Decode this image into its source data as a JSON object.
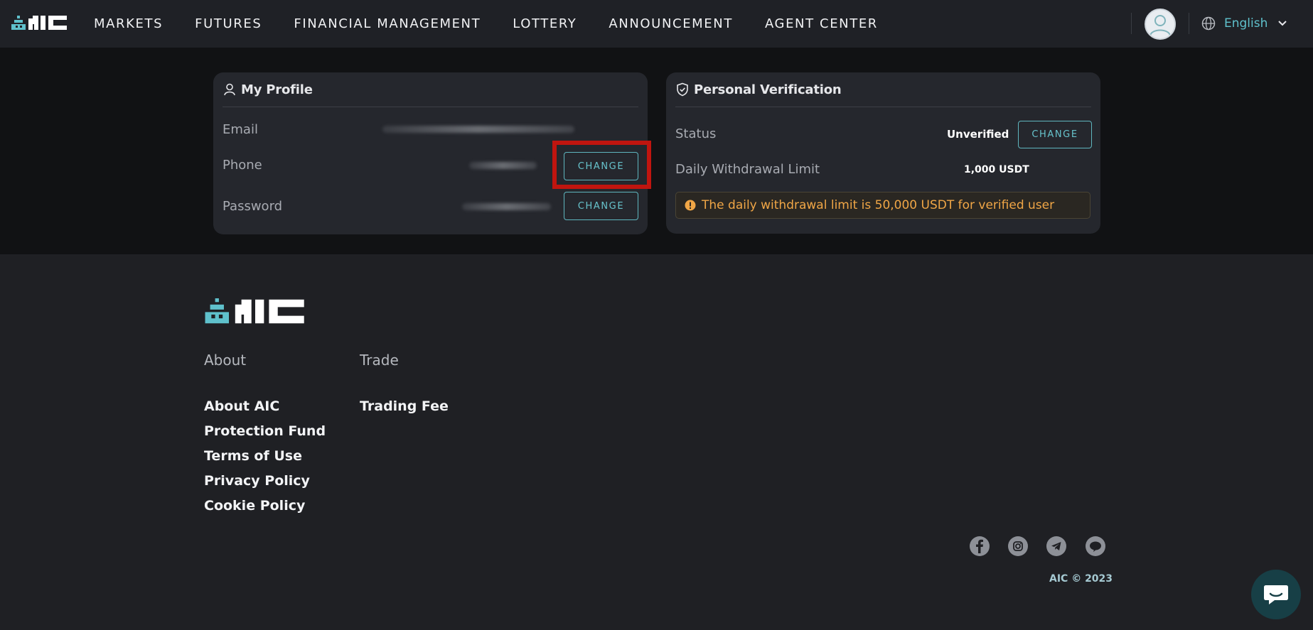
{
  "brand": {
    "name": "AIC",
    "logo_color": "#5fc1cc"
  },
  "nav": {
    "links": [
      "MARKETS",
      "FUTURES",
      "FINANCIAL MANAGEMENT",
      "LOTTERY",
      "ANNOUNCEMENT",
      "AGENT CENTER"
    ],
    "language": "English"
  },
  "profile": {
    "title": "My Profile",
    "rows": [
      {
        "label": "Email"
      },
      {
        "label": "Phone",
        "action": "CHANGE"
      },
      {
        "label": "Password",
        "action": "CHANGE"
      }
    ]
  },
  "verification": {
    "title": "Personal Verification",
    "status_label": "Status",
    "status_value": "Unverified",
    "status_action": "CHANGE",
    "limit_label": "Daily Withdrawal Limit",
    "limit_value": "1,000 USDT",
    "notice": "The daily withdrawal limit is 50,000 USDT for verified user"
  },
  "footer": {
    "columns": [
      {
        "heading": "About",
        "links": [
          "About AIC",
          "Protection Fund",
          "Terms of Use",
          "Privacy Policy",
          "Cookie Policy"
        ]
      },
      {
        "heading": "Trade",
        "links": [
          "Trading Fee"
        ]
      }
    ],
    "social": [
      "facebook-icon",
      "instagram-icon",
      "telegram-icon",
      "line-icon"
    ],
    "copyright": "AIC © 2023"
  },
  "colors": {
    "accent": "#5fc1cc",
    "warning": "#f0a646",
    "highlight": "#c0150f"
  }
}
